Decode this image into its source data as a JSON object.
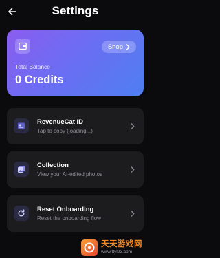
{
  "header": {
    "title": "Settings",
    "back_icon": "arrow-left-icon"
  },
  "balance_card": {
    "wallet_icon": "wallet-icon",
    "shop_label": "Shop",
    "shop_icon": "chevron-right-icon",
    "label": "Total Balance",
    "value": "0 Credits",
    "gradient_start": "#8a5cf0",
    "gradient_end": "#4f7ff2"
  },
  "rows": [
    {
      "icon": "id-card-icon",
      "title": "RevenueCat ID",
      "subtitle": "Tap to copy (loading...)"
    },
    {
      "icon": "gallery-icon",
      "title": "Collection",
      "subtitle": "View your AI-edited photos"
    },
    {
      "icon": "refresh-icon",
      "title": "Reset Onboarding",
      "subtitle": "Reset the onboarding flow"
    }
  ],
  "colors": {
    "background": "#0b0b0d",
    "row_background": "#1c1c1f",
    "icon_tile": "#2a2a42",
    "subtitle": "#8d8d93"
  },
  "watermark": {
    "title": "天天游戏网",
    "url": "www.ttyl23.com"
  }
}
